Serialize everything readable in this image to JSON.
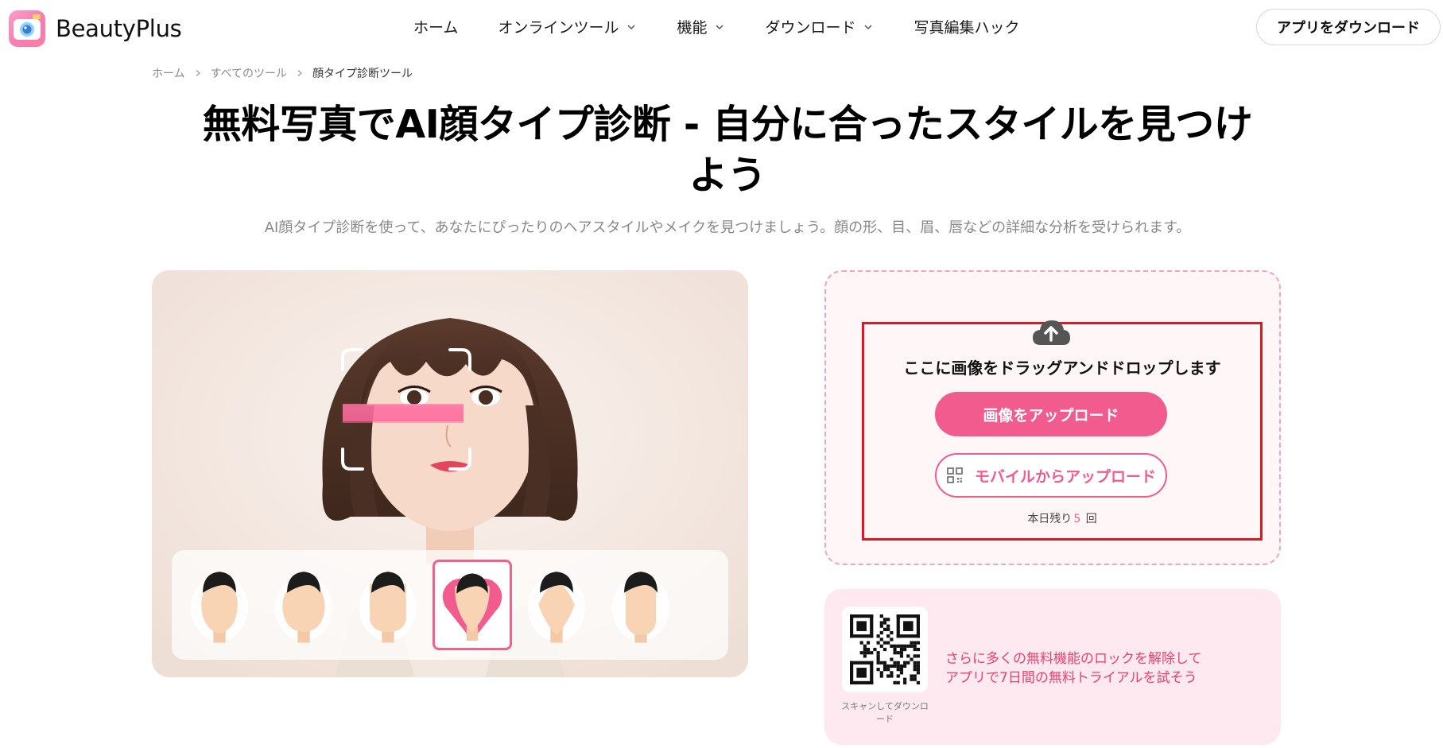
{
  "brand": {
    "name": "BeautyPlus"
  },
  "nav": {
    "items": [
      {
        "label": "ホーム",
        "has_dropdown": false
      },
      {
        "label": "オンラインツール",
        "has_dropdown": true
      },
      {
        "label": "機能",
        "has_dropdown": true
      },
      {
        "label": "ダウンロード",
        "has_dropdown": true
      },
      {
        "label": "写真編集ハック",
        "has_dropdown": false
      }
    ],
    "download_button": "アプリをダウンロード"
  },
  "breadcrumb": [
    "ホーム",
    "すべてのツール",
    "顔タイプ診断ツール"
  ],
  "page": {
    "title_line1": "無料写真でAI顔タイプ診断 - 自分に合ったスタイルを見つけ",
    "title_line2": "よう",
    "subtitle": "AI顔タイプ診断を使って、あなたにぴったりのヘアスタイルやメイクを見つけましょう。顔の形、目、眉、唇などの詳細な分析を受けられます。"
  },
  "face_shapes": {
    "count": 6,
    "selected_index": 3,
    "icons": [
      "oval-face-icon",
      "round-face-icon",
      "square-face-icon",
      "heart-face-icon",
      "diamond-face-icon",
      "oblong-face-icon"
    ]
  },
  "upload": {
    "drop_text": "ここに画像をドラッグアンドドロップします",
    "upload_button": "画像をアップロード",
    "mobile_button": "モバイルからアップロード",
    "remaining_prefix": "本日残り",
    "remaining_count": "5",
    "remaining_suffix": "回"
  },
  "promo": {
    "qr_caption": "スキャンしてダウンロード",
    "line1": "さらに多くの無料機能のロックを解除して",
    "line2": "アプリで7日間の無料トライアルを試そう"
  },
  "colors": {
    "accent": "#f25b8e",
    "promo_text": "#f0406e",
    "highlight_border": "#e31520",
    "panel_bg": "#fff6f8",
    "promo_bg": "#fde9ef"
  }
}
